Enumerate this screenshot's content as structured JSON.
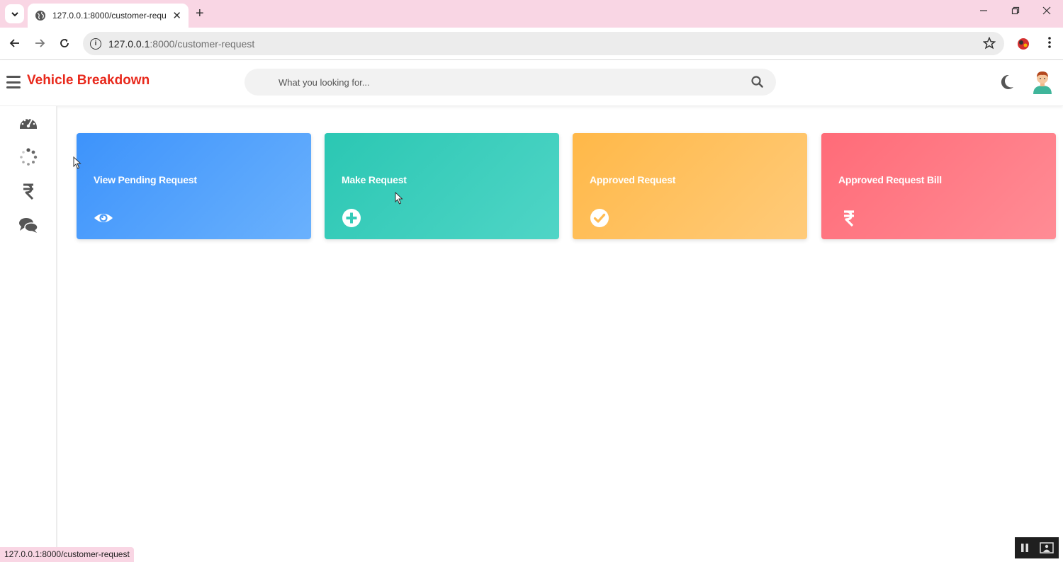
{
  "browser": {
    "tab_title": "127.0.0.1:8000/customer-request",
    "url_host": "127.0.0.1",
    "url_path": ":8000/customer-request",
    "status_url": "127.0.0.1:8000/customer-request"
  },
  "header": {
    "brand": "Vehicle Breakdown",
    "search_placeholder": "What you looking for..."
  },
  "sidebar": {
    "items": [
      {
        "icon": "dashboard-gauge-icon"
      },
      {
        "icon": "spinner-icon"
      },
      {
        "icon": "rupee-icon"
      },
      {
        "icon": "chat-bubbles-icon"
      }
    ]
  },
  "cards": [
    {
      "title": "View Pending Request",
      "icon": "eye-icon",
      "color": "#3d93fb"
    },
    {
      "title": "Make Request",
      "icon": "plus-circle-icon",
      "color": "#2bc7b3"
    },
    {
      "title": "Approved Request",
      "icon": "check-circle-icon",
      "color": "#ffb848"
    },
    {
      "title": "Approved Request Bill",
      "icon": "rupee-icon",
      "color": "#ff6b78"
    }
  ],
  "colors": {
    "brand": "#e8291c",
    "chrome": "#f9d6e4"
  }
}
